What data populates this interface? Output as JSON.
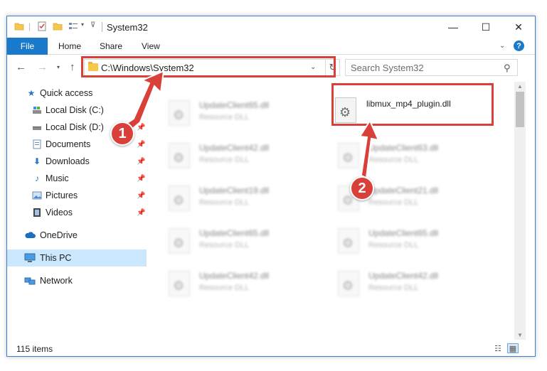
{
  "window": {
    "title": "System32",
    "controls": {
      "minimize": "—",
      "maximize": "☐",
      "close": "✕"
    }
  },
  "ribbon": {
    "tabs": [
      {
        "label": "File"
      },
      {
        "label": "Home"
      },
      {
        "label": "Share"
      },
      {
        "label": "View"
      }
    ],
    "help": "?"
  },
  "address": {
    "path": "C:\\Windows\\System32",
    "search_placeholder": "Search System32"
  },
  "sidebar": {
    "items": [
      {
        "label": "Quick access",
        "icon": "star-icon",
        "pinned": false
      },
      {
        "label": "Local Disk (C:)",
        "icon": "drive-icon",
        "pinned": true
      },
      {
        "label": "Local Disk (D:)",
        "icon": "drive-icon",
        "pinned": true
      },
      {
        "label": "Documents",
        "icon": "documents-icon",
        "pinned": true
      },
      {
        "label": "Downloads",
        "icon": "download-icon",
        "pinned": true
      },
      {
        "label": "Music",
        "icon": "music-icon",
        "pinned": true
      },
      {
        "label": "Pictures",
        "icon": "pictures-icon",
        "pinned": true
      },
      {
        "label": "Videos",
        "icon": "videos-icon",
        "pinned": true
      },
      {
        "label": "OneDrive",
        "icon": "cloud-icon",
        "pinned": false
      },
      {
        "label": "This PC",
        "icon": "computer-icon",
        "pinned": false,
        "selected": true
      },
      {
        "label": "Network",
        "icon": "network-icon",
        "pinned": false
      }
    ]
  },
  "files": {
    "highlighted": {
      "name": "libmux_mp4_plugin.dll",
      "type": ""
    },
    "left_column": [
      {
        "name": "UpdateClient65.dll",
        "type": "Resource DLL"
      },
      {
        "name": "UpdateClient42.dll",
        "type": "Resource DLL"
      },
      {
        "name": "UpdateClient19.dll",
        "type": "Resource DLL"
      },
      {
        "name": "UpdateClient65.dll",
        "type": "Resource DLL"
      },
      {
        "name": "UpdateClient42.dll",
        "type": "Resource DLL"
      }
    ],
    "right_column": [
      {
        "name": "UpdateClient63.dll",
        "type": "Resource DLL"
      },
      {
        "name": "UpdateClient21.dll",
        "type": "Resource DLL"
      },
      {
        "name": "UpdateClient65.dll",
        "type": "Resource DLL"
      },
      {
        "name": "UpdateClient42.dll",
        "type": "Resource DLL"
      }
    ]
  },
  "status": {
    "item_count": "115 items"
  },
  "callouts": {
    "step1": "1",
    "step2": "2"
  },
  "colors": {
    "accent": "#1979ca",
    "highlight": "#d9403a",
    "selected": "#cce8ff"
  }
}
